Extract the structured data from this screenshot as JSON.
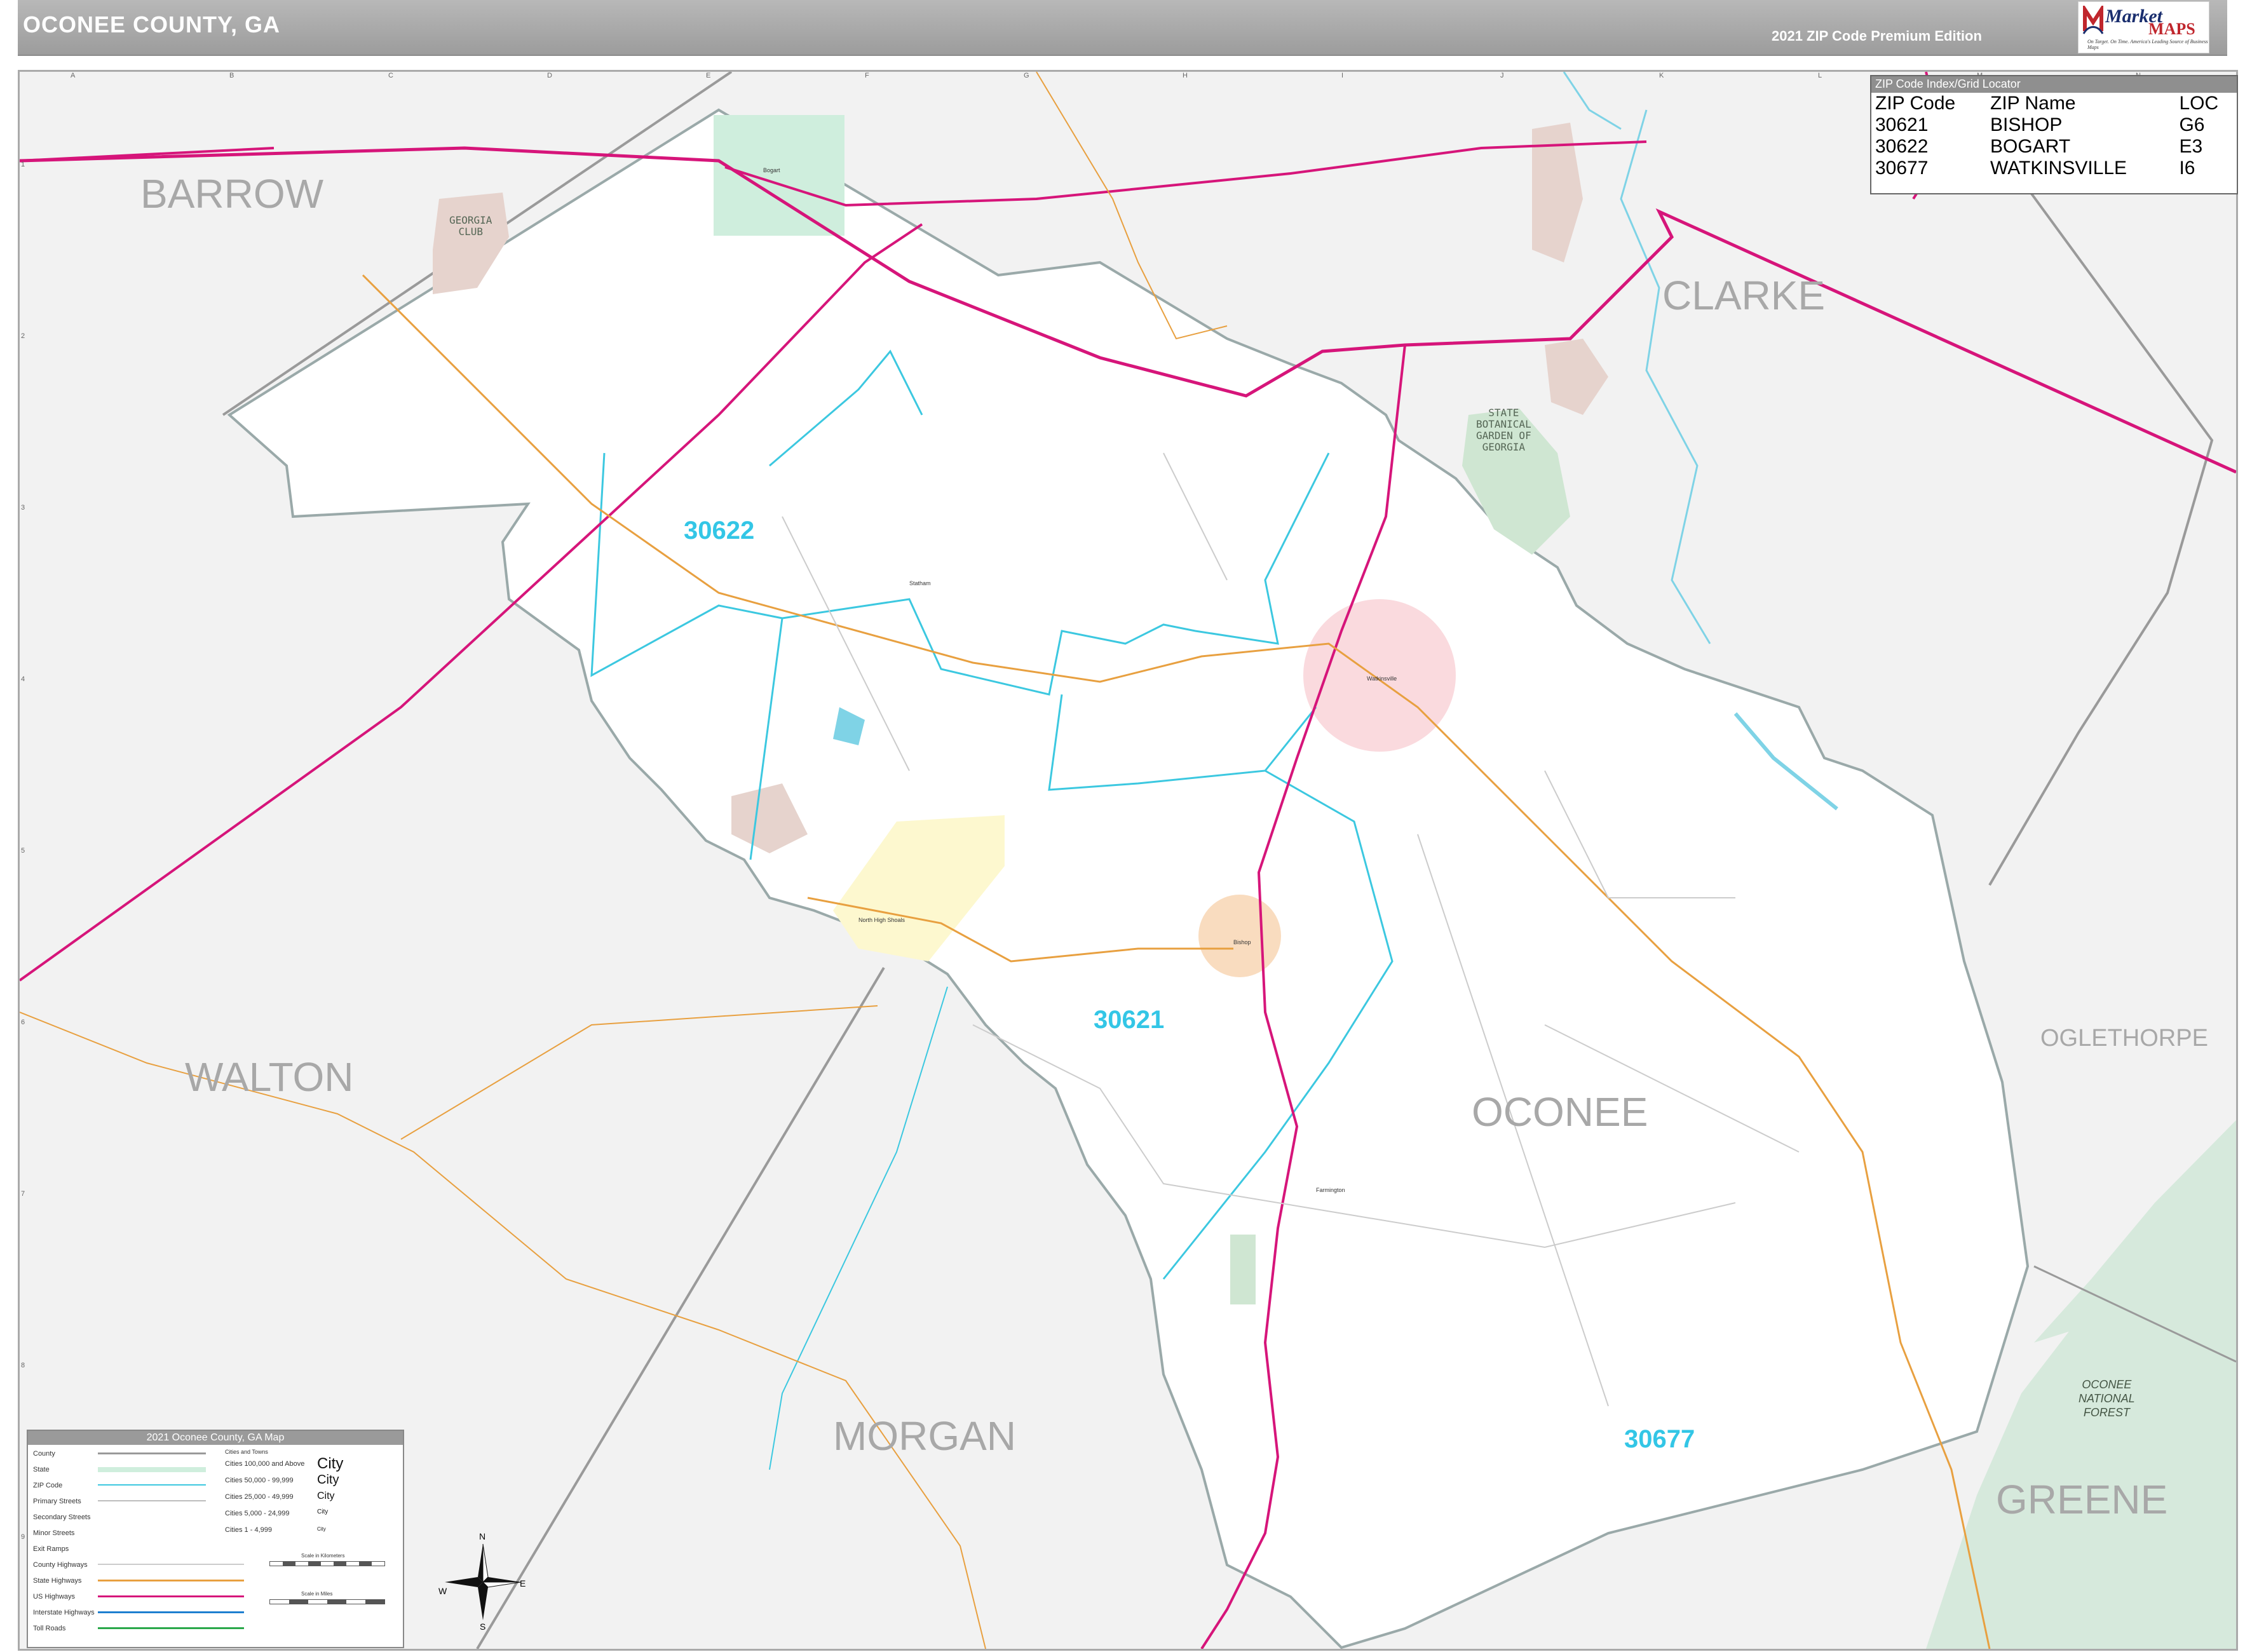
{
  "header": {
    "title": "OCONEE COUNTY, GA",
    "edition": "2021 ZIP Code Premium Edition",
    "logo_brand": "Market",
    "logo_brand2": "MAPS",
    "logo_tagline": "On Target. On Time. America's Leading Source of Business Maps"
  },
  "grid": {
    "letters": [
      "A",
      "B",
      "C",
      "D",
      "E",
      "F",
      "G",
      "H",
      "I",
      "J",
      "K",
      "L",
      "M",
      "N"
    ],
    "numbers": [
      "1",
      "2",
      "3",
      "4",
      "5",
      "6",
      "7",
      "8",
      "9"
    ]
  },
  "counties": {
    "barrow": "BARROW",
    "clarke": "CLARKE",
    "walton": "WALTON",
    "oconee": "OCONEE",
    "oglethorpe": "OGLETHORPE",
    "morgan": "MORGAN",
    "greene": "GREENE"
  },
  "zip_labels": {
    "z30622": "30622",
    "z30621": "30621",
    "z30677": "30677"
  },
  "places": {
    "georgia_club": "GEORGIA\nCLUB",
    "botanical": "STATE\nBOTANICAL\nGARDEN OF\nGEORGIA",
    "forest": "OCONEE\nNATIONAL\nFOREST",
    "north_high_shoals": "North High Shoals",
    "bishop": "Bishop",
    "farmington": "Farmington",
    "watkinsville": "Watkinsville",
    "bogart": "Bogart",
    "statham": "Statham"
  },
  "zip_index": {
    "title": "ZIP Code Index/Grid Locator",
    "headers": [
      "ZIP Code",
      "ZIP Name",
      "LOC"
    ],
    "rows": [
      [
        "30621",
        "BISHOP",
        "G6"
      ],
      [
        "30622",
        "BOGART",
        "E3"
      ],
      [
        "30677",
        "WATKINSVILLE",
        "I6"
      ]
    ]
  },
  "legend": {
    "title": "2021 Oconee County, GA Map",
    "items": [
      "County",
      "State",
      "ZIP Code",
      "Primary Streets",
      "Secondary Streets",
      "Minor Streets",
      "Exit Ramps",
      "County Highways",
      "State Highways",
      "US Highways",
      "Interstate Highways",
      "Toll Roads"
    ],
    "cities_header": "Cities and Towns",
    "cities": [
      "Cities 100,000 and Above",
      "Cities 50,000 - 99,999",
      "Cities 25,000 - 49,999",
      "Cities 5,000 - 24,999",
      "Cities 1 - 4,999"
    ],
    "city_samples": [
      "City",
      "City",
      "City",
      "City",
      "City"
    ],
    "scale_km": "Scale in Kilometers",
    "scale_mi": "Scale in Miles"
  },
  "compass": {
    "n": "N",
    "s": "S",
    "e": "E",
    "w": "W"
  },
  "colors": {
    "us_highway": "#d6157a",
    "state_highway": "#e8a040",
    "zip_boundary": "#3cc8e0",
    "county_boundary": "#9a9a9a",
    "water": "#7fd3e6",
    "park": "#cfe6d2",
    "forest": "#d6e9dc"
  }
}
